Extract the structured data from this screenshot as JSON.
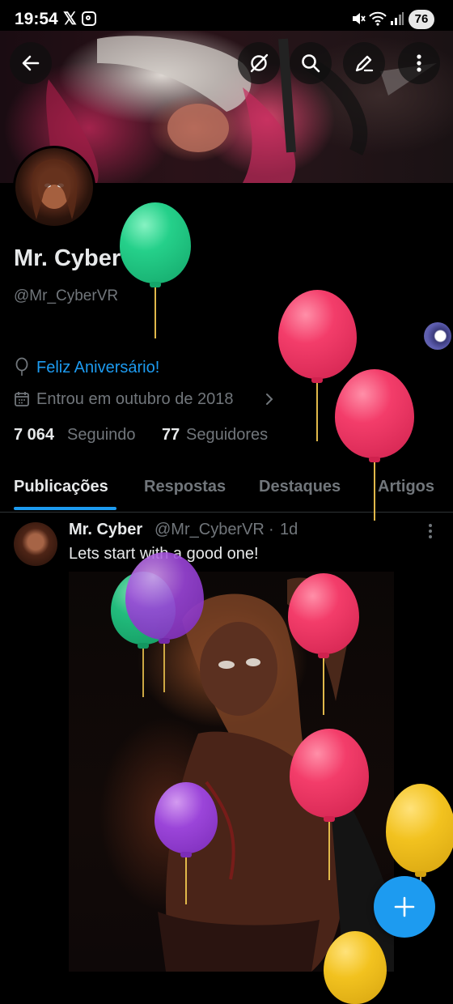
{
  "status_bar": {
    "time": "19:54",
    "battery": "76",
    "icons": [
      "x-logo-icon",
      "instagram-icon",
      "mute-icon",
      "wifi-icon",
      "signal-icon"
    ]
  },
  "profile": {
    "display_name": "Mr. Cyber",
    "handle": "@Mr_CyberVR",
    "birthday_text": "Feliz Aniversário!",
    "joined_text": "Entrou em outubro de 2018",
    "following_count": "7 064",
    "following_label": "Seguindo",
    "followers_count": "77",
    "followers_label": "Seguidores"
  },
  "tabs": [
    {
      "label": "Publicações",
      "active": true
    },
    {
      "label": "Respostas",
      "active": false
    },
    {
      "label": "Destaques",
      "active": false
    },
    {
      "label": "Artigos",
      "active": false
    }
  ],
  "post": {
    "author": "Mr. Cyber",
    "handle": "@Mr_CyberVR",
    "separator": "·",
    "time": "1d",
    "text": "Lets start with a good one!"
  },
  "colors": {
    "accent": "#1d9bf0",
    "secondary_text": "#71767b",
    "primary_text": "#e7e9ea",
    "balloon_green": "#25d08a",
    "balloon_red": "#f33d6a",
    "balloon_purple": "#9b45d9",
    "balloon_yellow": "#f2c21f"
  }
}
